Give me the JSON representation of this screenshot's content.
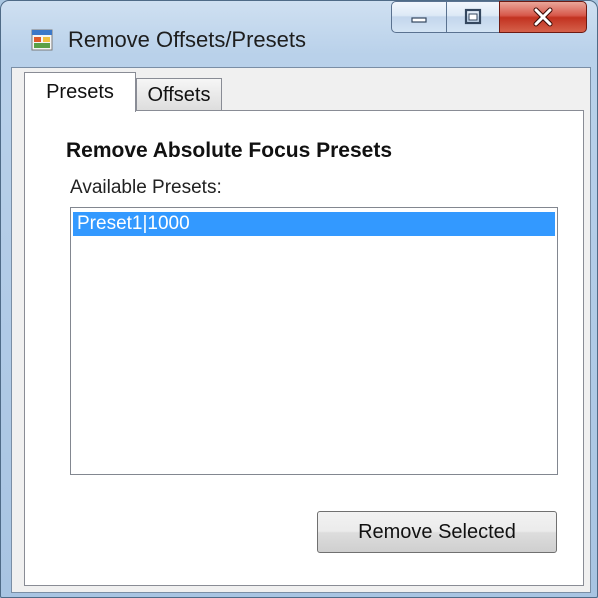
{
  "window": {
    "title": "Remove Offsets/Presets"
  },
  "tabs": [
    {
      "label": "Presets",
      "active": true
    },
    {
      "label": "Offsets",
      "active": false
    }
  ],
  "presets_tab": {
    "section_title": "Remove Absolute Focus Presets",
    "list_label": "Available Presets:",
    "items": [
      {
        "text": "Preset1|1000",
        "selected": true
      }
    ],
    "remove_button_label": "Remove Selected"
  },
  "icons": {
    "app": "application-icon",
    "minimize": "minimize-icon",
    "maximize": "maximize-icon",
    "close": "close-icon"
  },
  "colors": {
    "selection": "#3399ff",
    "close_button": "#c23220"
  }
}
